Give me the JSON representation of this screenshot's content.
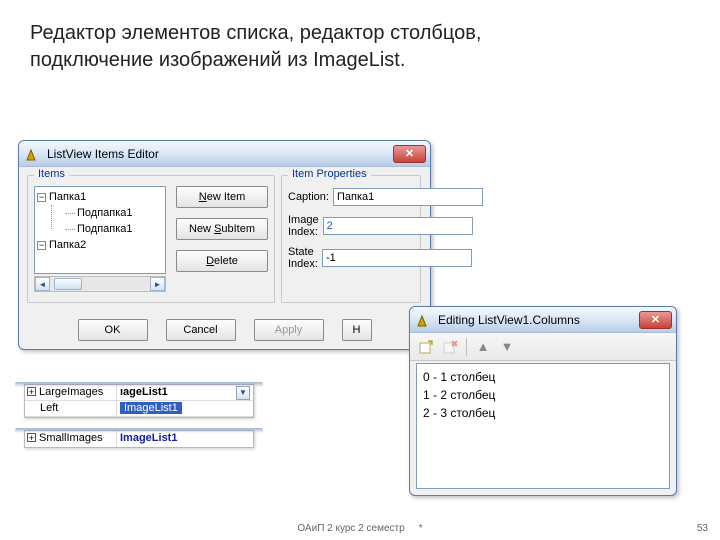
{
  "heading": {
    "line1": "Редактор элементов списка, редактор столбцов,",
    "line2": "подключение изображений из ImageList."
  },
  "editor1": {
    "title": "ListView Items Editor",
    "group_items": "Items",
    "group_props": "Item Properties",
    "tree": {
      "n1": "Папка1",
      "n1a": "Подпапка1",
      "n1b": "Подпапка1",
      "n2": "Папка2"
    },
    "buttons": {
      "new_item_pre": "N",
      "new_item_rest": "ew Item",
      "new_sub_pre": "New ",
      "new_sub_u": "S",
      "new_sub_rest": "ubItem",
      "delete_u": "D",
      "delete_rest": "elete",
      "ok": "OK",
      "cancel": "Cancel",
      "apply": "Apply",
      "help": "H"
    },
    "props": {
      "caption_label": "Caption:",
      "caption_value": "Папка1",
      "image_label": "Image Index:",
      "image_value": "2",
      "state_label": "State Index:",
      "state_value": "-1"
    }
  },
  "editor2": {
    "title": "Editing ListView1.Columns",
    "items": {
      "i0": "0 - 1 столбец",
      "i1": "1 - 2 столбец",
      "i2": "2 - 3 столбец"
    }
  },
  "snips": {
    "largeimages_label": "LargeImages",
    "largeimages_masked": "ıageList1",
    "largeimages_selected": "ImageList1",
    "left_label": "Left",
    "smallimages_label": "SmallImages",
    "smallimages_value": "ImageList1"
  },
  "footer": {
    "course": "ОАиП 2 курс 2 семестр",
    "mark": "*",
    "page": "53"
  },
  "glyphs": {
    "x": "✕",
    "minus": "−",
    "plus": "+",
    "left": "◄",
    "right": "►",
    "up": "▲",
    "down": "▼",
    "dd": "▼"
  }
}
